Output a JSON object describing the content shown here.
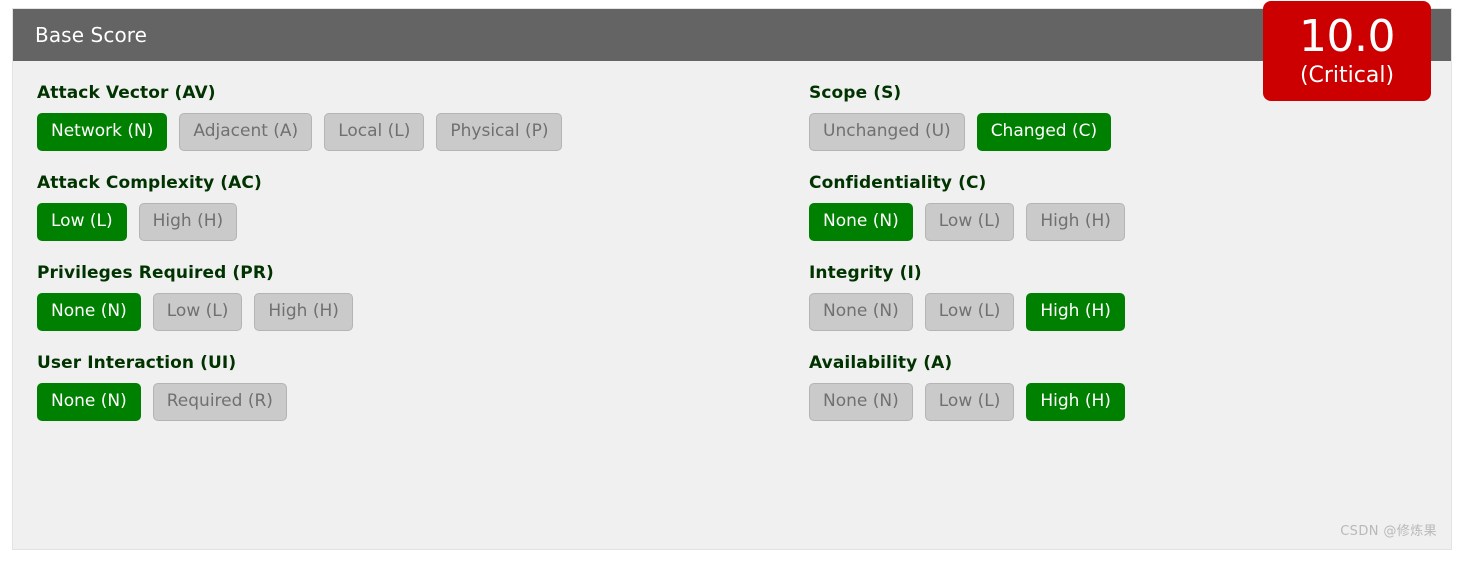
{
  "panel": {
    "title": "Base Score"
  },
  "score": {
    "value": "10.0",
    "rating": "(Critical)",
    "color": "#cc0000"
  },
  "colors": {
    "header_bg": "#646464",
    "body_bg": "#f0f0f0",
    "selected_bg": "#008000",
    "unselected_bg": "#cacaca",
    "label_text": "#003300"
  },
  "left_column": [
    {
      "label": "Attack Vector (AV)",
      "options": [
        {
          "text": "Network (N)",
          "selected": true
        },
        {
          "text": "Adjacent (A)",
          "selected": false
        },
        {
          "text": "Local (L)",
          "selected": false
        },
        {
          "text": "Physical (P)",
          "selected": false
        }
      ]
    },
    {
      "label": "Attack Complexity (AC)",
      "options": [
        {
          "text": "Low (L)",
          "selected": true
        },
        {
          "text": "High (H)",
          "selected": false
        }
      ]
    },
    {
      "label": "Privileges Required (PR)",
      "options": [
        {
          "text": "None (N)",
          "selected": true
        },
        {
          "text": "Low (L)",
          "selected": false
        },
        {
          "text": "High (H)",
          "selected": false
        }
      ]
    },
    {
      "label": "User Interaction (UI)",
      "options": [
        {
          "text": "None (N)",
          "selected": true
        },
        {
          "text": "Required (R)",
          "selected": false
        }
      ]
    }
  ],
  "right_column": [
    {
      "label": "Scope (S)",
      "options": [
        {
          "text": "Unchanged (U)",
          "selected": false
        },
        {
          "text": "Changed (C)",
          "selected": true
        }
      ]
    },
    {
      "label": "Confidentiality (C)",
      "options": [
        {
          "text": "None (N)",
          "selected": true
        },
        {
          "text": "Low (L)",
          "selected": false
        },
        {
          "text": "High (H)",
          "selected": false
        }
      ]
    },
    {
      "label": "Integrity (I)",
      "options": [
        {
          "text": "None (N)",
          "selected": false
        },
        {
          "text": "Low (L)",
          "selected": false
        },
        {
          "text": "High (H)",
          "selected": true
        }
      ]
    },
    {
      "label": "Availability (A)",
      "options": [
        {
          "text": "None (N)",
          "selected": false
        },
        {
          "text": "Low (L)",
          "selected": false
        },
        {
          "text": "High (H)",
          "selected": true
        }
      ]
    }
  ],
  "watermark": "CSDN @修炼果"
}
